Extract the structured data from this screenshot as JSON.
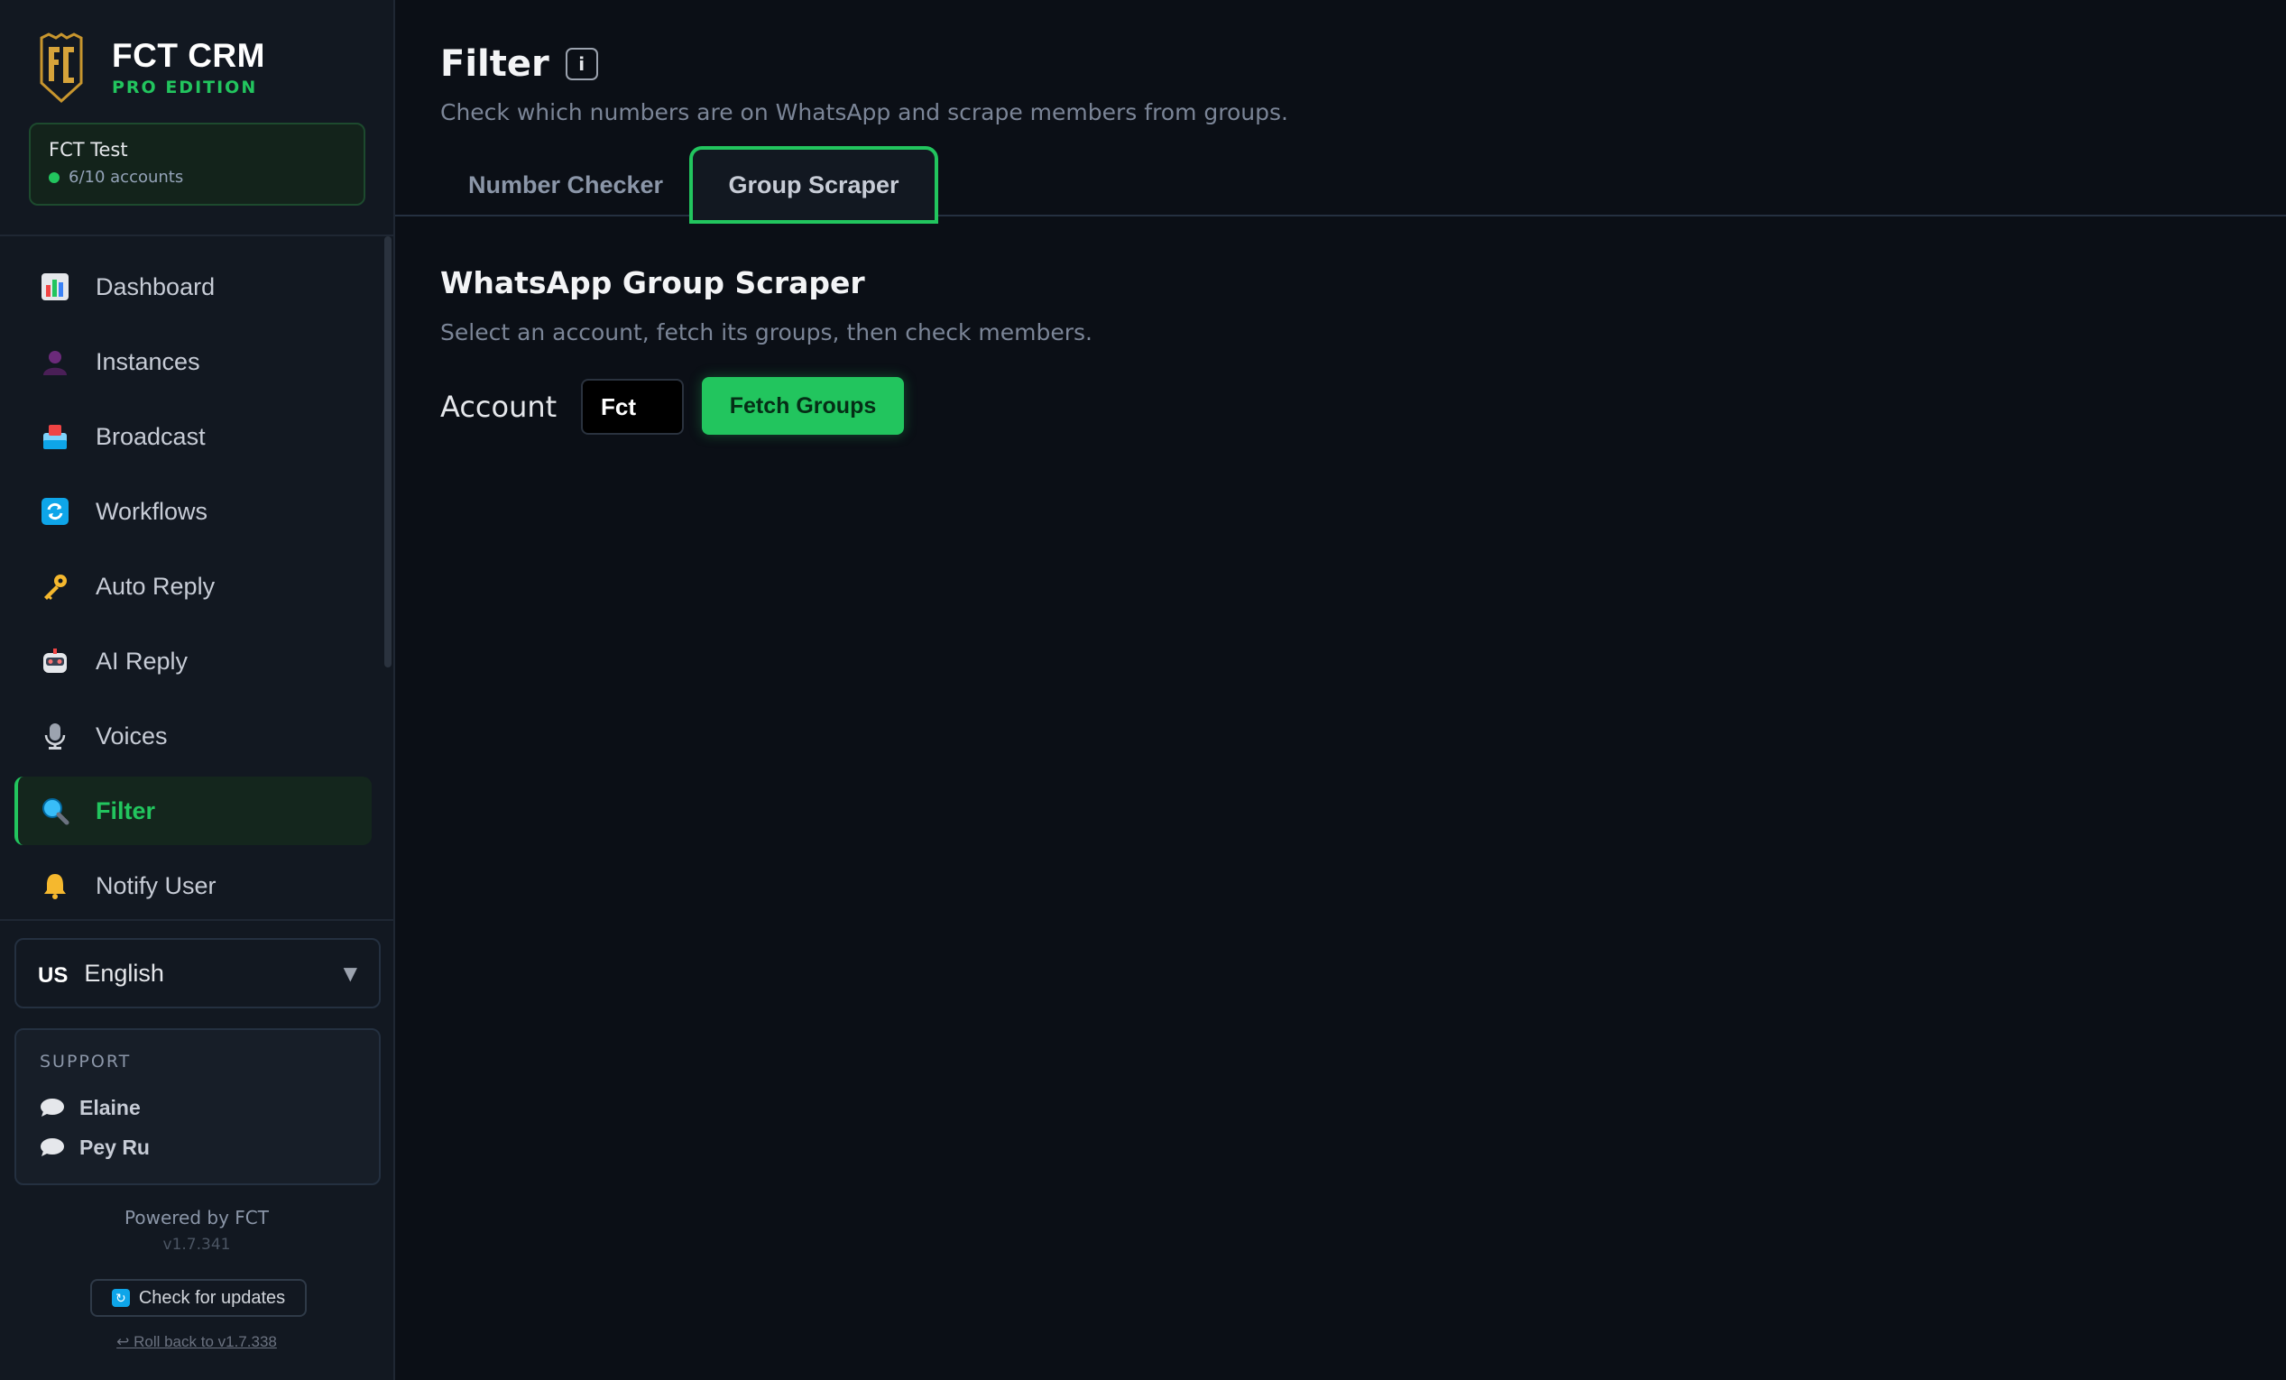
{
  "brand": {
    "title": "FCT CRM",
    "subtitle": "PRO EDITION"
  },
  "workspace": {
    "name": "FCT Test",
    "accounts": "6/10 accounts"
  },
  "nav": {
    "items": [
      {
        "label": "Dashboard",
        "icon": "bar-chart-icon"
      },
      {
        "label": "Instances",
        "icon": "user-icon"
      },
      {
        "label": "Broadcast",
        "icon": "inbox-icon"
      },
      {
        "label": "Workflows",
        "icon": "refresh-icon"
      },
      {
        "label": "Auto Reply",
        "icon": "key-icon"
      },
      {
        "label": "AI Reply",
        "icon": "robot-icon"
      },
      {
        "label": "Voices",
        "icon": "microphone-icon"
      },
      {
        "label": "Filter",
        "icon": "magnifier-icon",
        "active": true
      },
      {
        "label": "Notify User",
        "icon": "bell-icon"
      }
    ]
  },
  "language": {
    "flag": "US",
    "selected": "English"
  },
  "support": {
    "title": "SUPPORT",
    "contacts": [
      "Elaine",
      "Pey Ru"
    ]
  },
  "footer": {
    "powered": "Powered by FCT",
    "version": "v1.7.341",
    "update_label": "Check for updates",
    "rollback_label": "↩ Roll back to v1.7.338"
  },
  "page": {
    "title": "Filter",
    "description": "Check which numbers are on WhatsApp and scrape members from groups.",
    "tabs": [
      {
        "label": "Number Checker",
        "active": false
      },
      {
        "label": "Group Scraper",
        "active": true
      }
    ]
  },
  "scraper": {
    "title": "WhatsApp Group Scraper",
    "description": "Select an account, fetch its groups, then check members.",
    "account_label": "Account",
    "account_value": "Fct",
    "fetch_label": "Fetch Groups"
  },
  "colors": {
    "accent": "#22c55e",
    "background": "#0b0f16",
    "sidebar": "#121821"
  }
}
